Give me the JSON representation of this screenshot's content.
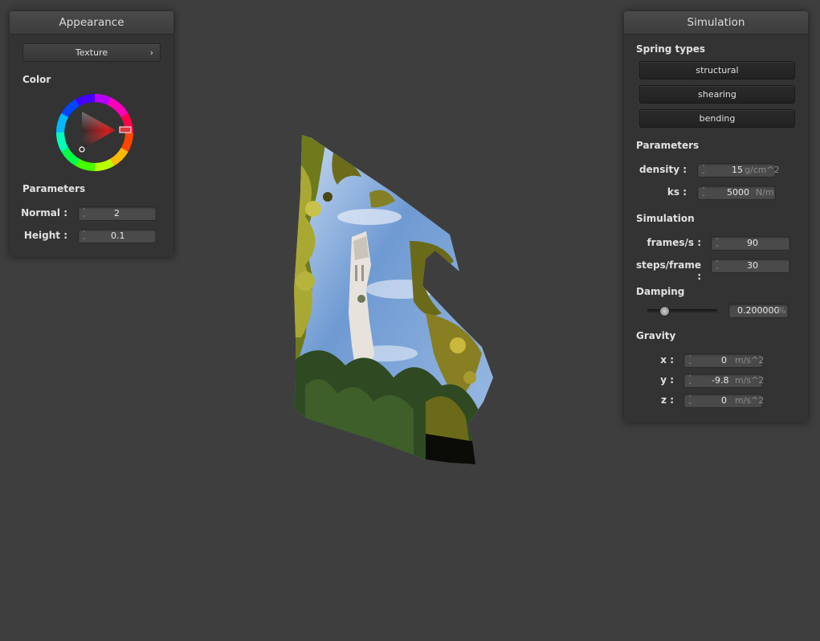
{
  "appearance": {
    "title": "Appearance",
    "texture_button": "Texture",
    "color_label": "Color",
    "parameters_label": "Parameters",
    "normal_label": "Normal :",
    "normal_value": "2",
    "height_label": "Height :",
    "height_value": "0.1",
    "selected_color": "#e0363e"
  },
  "simulation": {
    "title": "Simulation",
    "spring_types_label": "Spring types",
    "spring_buttons": [
      "structural",
      "shearing",
      "bending"
    ],
    "parameters_label": "Parameters",
    "density_label": "density :",
    "density_value": "15",
    "density_unit": "g/cm^2",
    "ks_label": "ks :",
    "ks_value": "5000",
    "ks_unit": "N/m",
    "simulation_label": "Simulation",
    "fps_label": "frames/s :",
    "fps_value": "90",
    "steps_label": "steps/frame :",
    "steps_value": "30",
    "damping_label": "Damping",
    "damping_value": "0.200000",
    "damping_unit": "%",
    "damping_fraction": 0.2,
    "gravity_label": "Gravity",
    "gx_label": "x :",
    "gx_value": "0",
    "gy_label": "y :",
    "gy_value": "-9.8",
    "gz_label": "z :",
    "gz_value": "0",
    "gravity_unit": "m/s^2"
  },
  "viewport": {
    "content": "textured cloth mesh",
    "icons": [
      "color-wheel-icon",
      "chevron-right-icon",
      "spinner-icon"
    ]
  }
}
